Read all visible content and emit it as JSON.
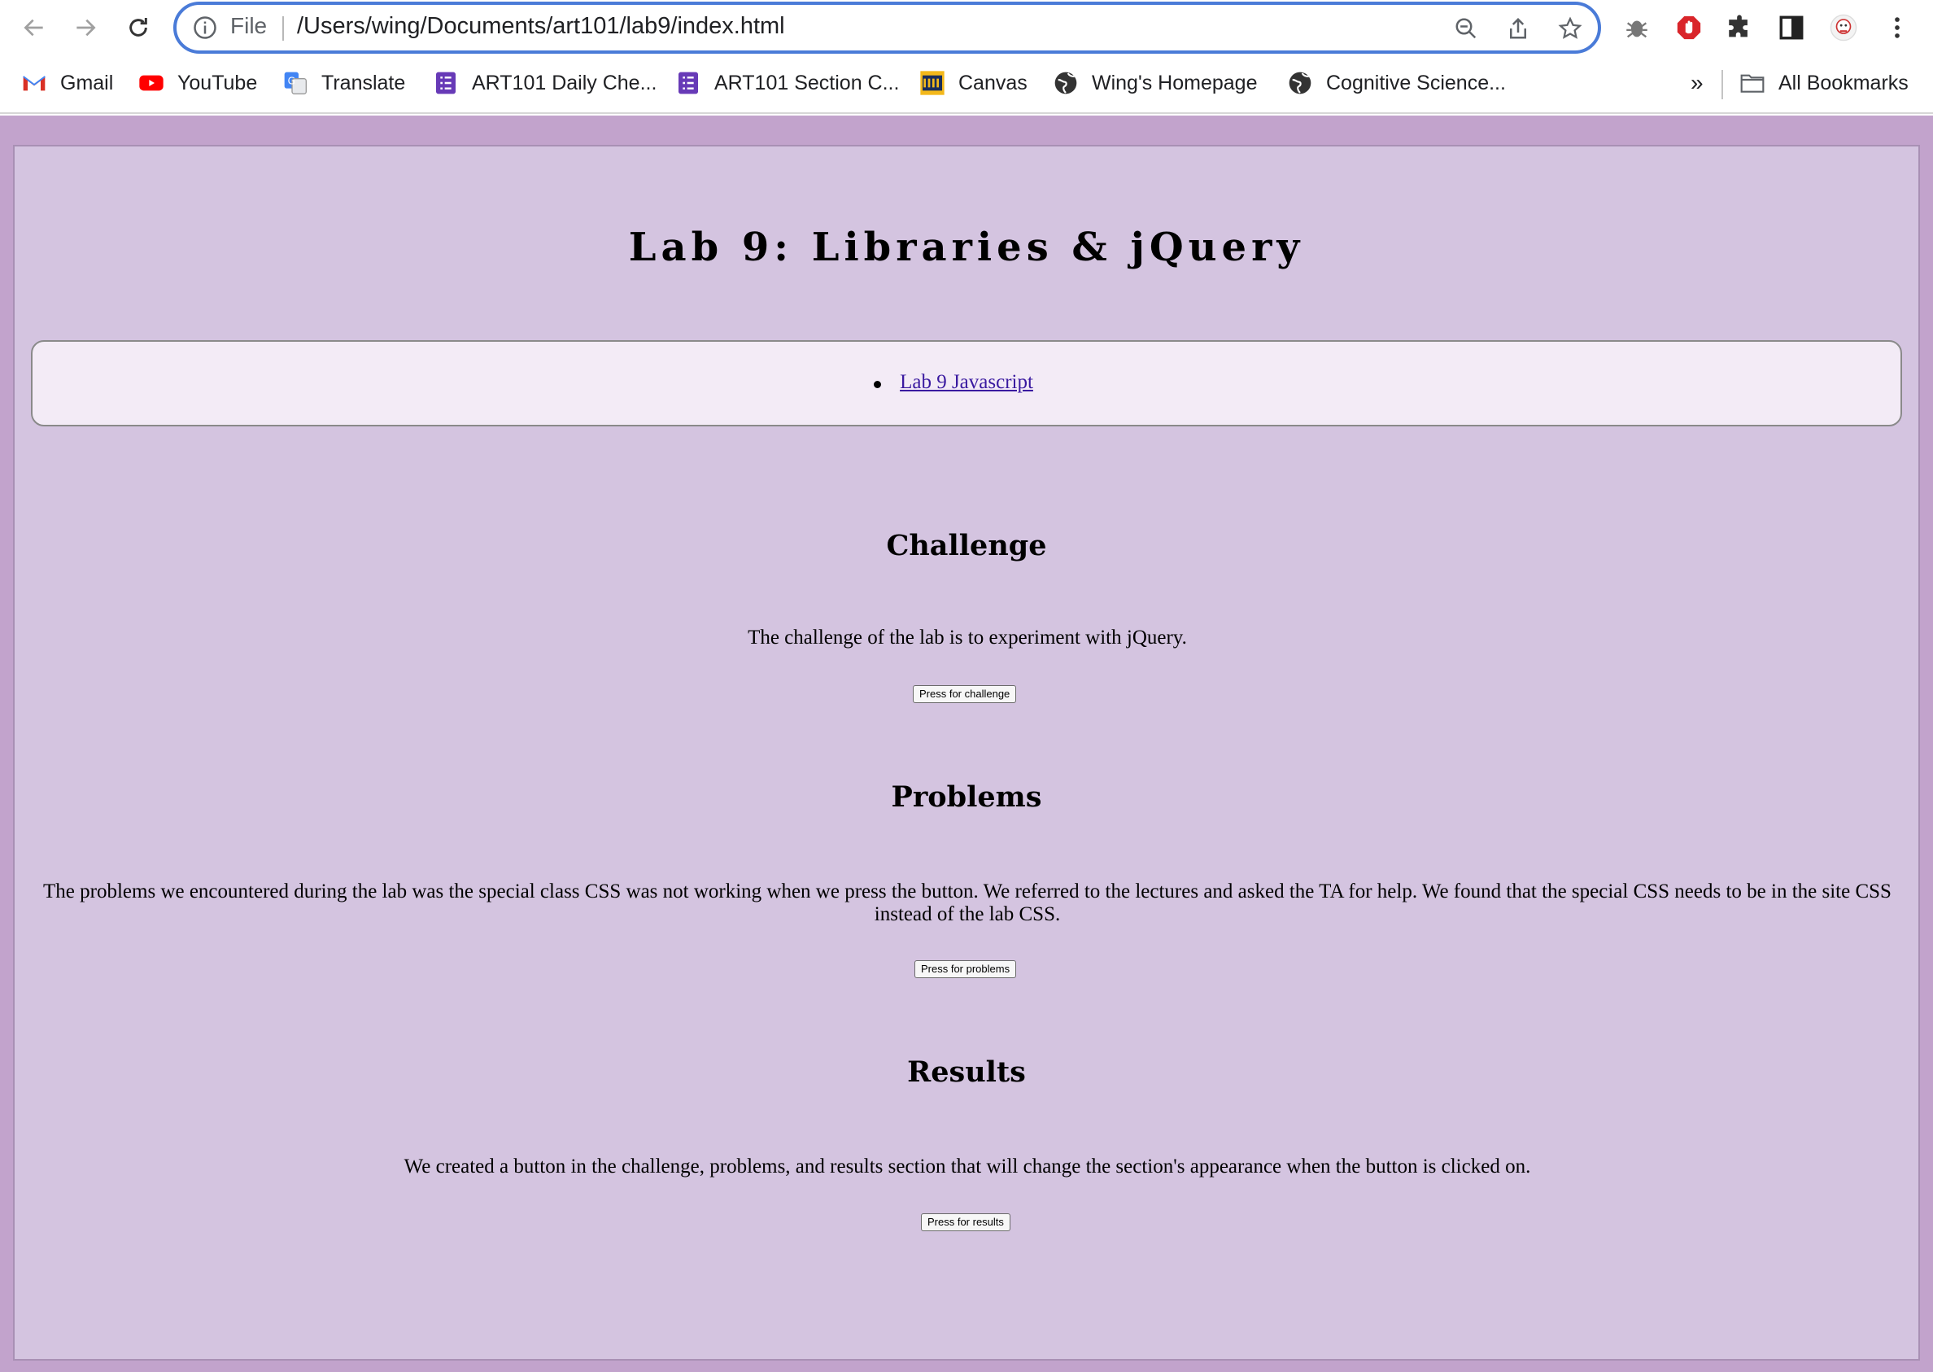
{
  "browser": {
    "omnibox": {
      "scheme_label": "File",
      "url": "/Users/wing/Documents/art101/lab9/index.html"
    },
    "bookmarks": [
      {
        "label": "Gmail",
        "icon": "gmail-icon"
      },
      {
        "label": "YouTube",
        "icon": "youtube-icon"
      },
      {
        "label": "Translate",
        "icon": "translate-icon"
      },
      {
        "label": "ART101 Daily Che...",
        "icon": "forms-icon"
      },
      {
        "label": "ART101 Section C...",
        "icon": "forms-icon"
      },
      {
        "label": "Canvas",
        "icon": "ucsc-icon"
      },
      {
        "label": "Wing's Homepage",
        "icon": "globe-icon"
      },
      {
        "label": "Cognitive Science...",
        "icon": "globe-icon"
      }
    ],
    "overflow_label": "»",
    "all_bookmarks_label": "All Bookmarks",
    "accent_color": "#4a7bd8"
  },
  "page": {
    "title": "Lab 9: Libraries & jQuery",
    "nav_links": [
      "Lab 9 Javascript"
    ],
    "sections": [
      {
        "heading": "Challenge",
        "text": "The challenge of the lab is to experiment with jQuery.",
        "button": "Press for challenge"
      },
      {
        "heading": "Problems",
        "text": "The problems we encountered during the lab was the special class CSS was not working when we press the button. We referred to the lectures and asked the TA for help. We found that the special CSS needs to be in the site CSS instead of the lab CSS.",
        "button": "Press for problems"
      },
      {
        "heading": "Results",
        "text": "We created a button in the challenge, problems, and results section that will change the section's appearance when the button is clicked on.",
        "button": "Press for results"
      }
    ],
    "colors": {
      "outer_background": "#c2a3cc",
      "content_background": "#d4c4e0",
      "nav_background": "#f3ebf6",
      "link": "#3a1aa0"
    }
  }
}
